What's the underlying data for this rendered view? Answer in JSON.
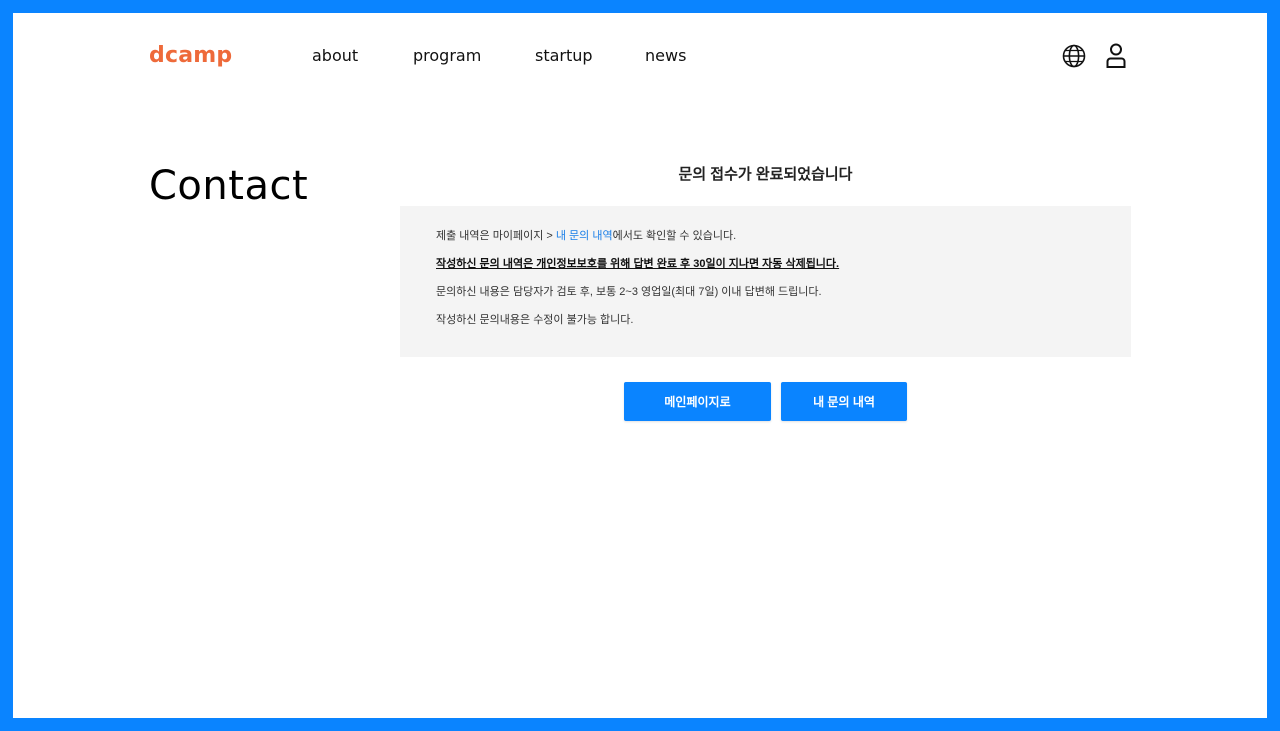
{
  "header": {
    "logo": "dcamp",
    "nav": [
      "about",
      "program",
      "startup",
      "news"
    ],
    "icons": [
      "globe-icon",
      "user-icon"
    ]
  },
  "page": {
    "title": "Contact"
  },
  "notice": {
    "heading": "문의 접수가 완료되었습니다",
    "line1_prefix": "제출 내역은 마이페이지 > ",
    "line1_link": "내 문의 내역",
    "line1_suffix": "에서도 확인할 수 있습니다.",
    "line2": "작성하신 문의 내역은 개인정보보호를 위해 답변 완료 후 30일이 지나면 자동 삭제됩니다.",
    "line3": "문의하신 내용은 담당자가 검토 후, 보통 2~3 영업일(최대 7일) 이내 답변해 드립니다.",
    "line4": "작성하신 문의내용은 수정이 불가능 합니다."
  },
  "buttons": {
    "main_page": "메인페이지로",
    "my_inquiries": "내 문의 내역"
  },
  "colors": {
    "frame": "#0a84ff",
    "logo": "#ee6a3a",
    "link": "#1a7fe8",
    "button": "#0a84ff",
    "box": "#f4f4f4"
  }
}
